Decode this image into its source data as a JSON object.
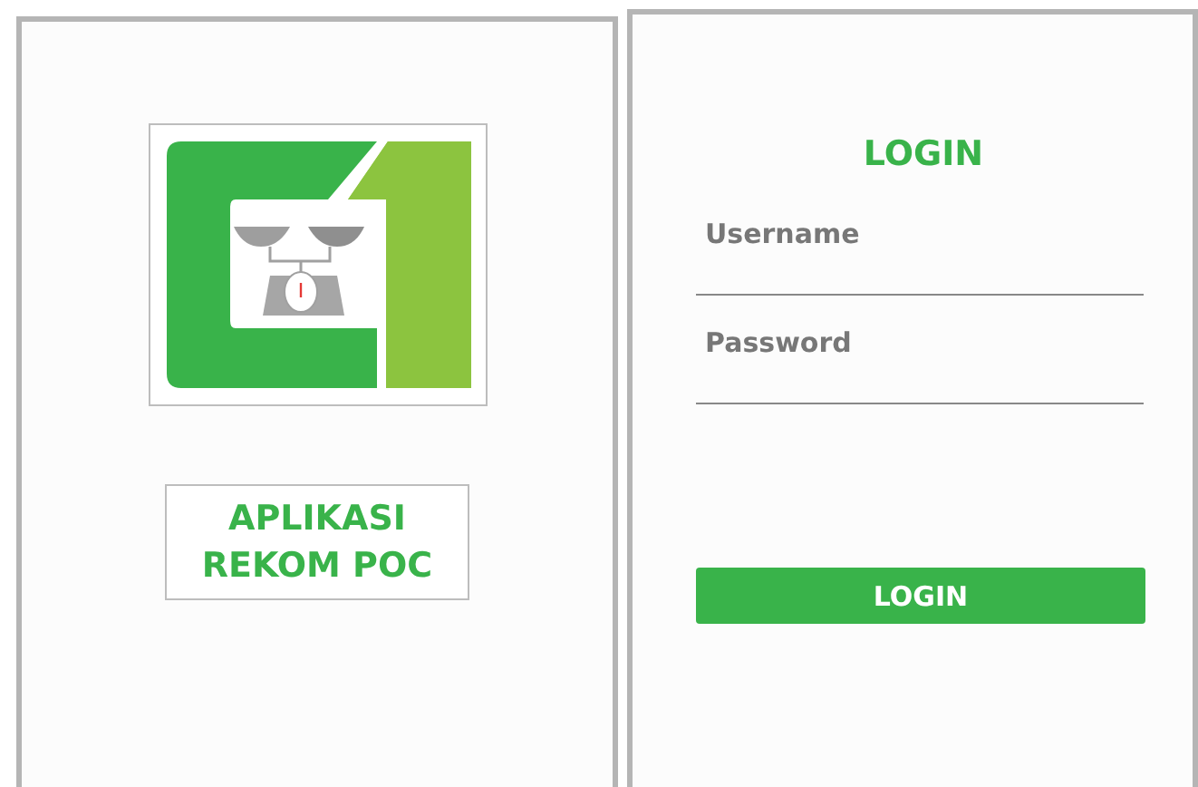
{
  "splash": {
    "app_name_lines": [
      "APLIKASI",
      "REKOM POC"
    ]
  },
  "login": {
    "title": "LOGIN",
    "fields": [
      {
        "placeholder": "Username"
      },
      {
        "placeholder": "Password"
      }
    ],
    "button": "LOGIN"
  }
}
